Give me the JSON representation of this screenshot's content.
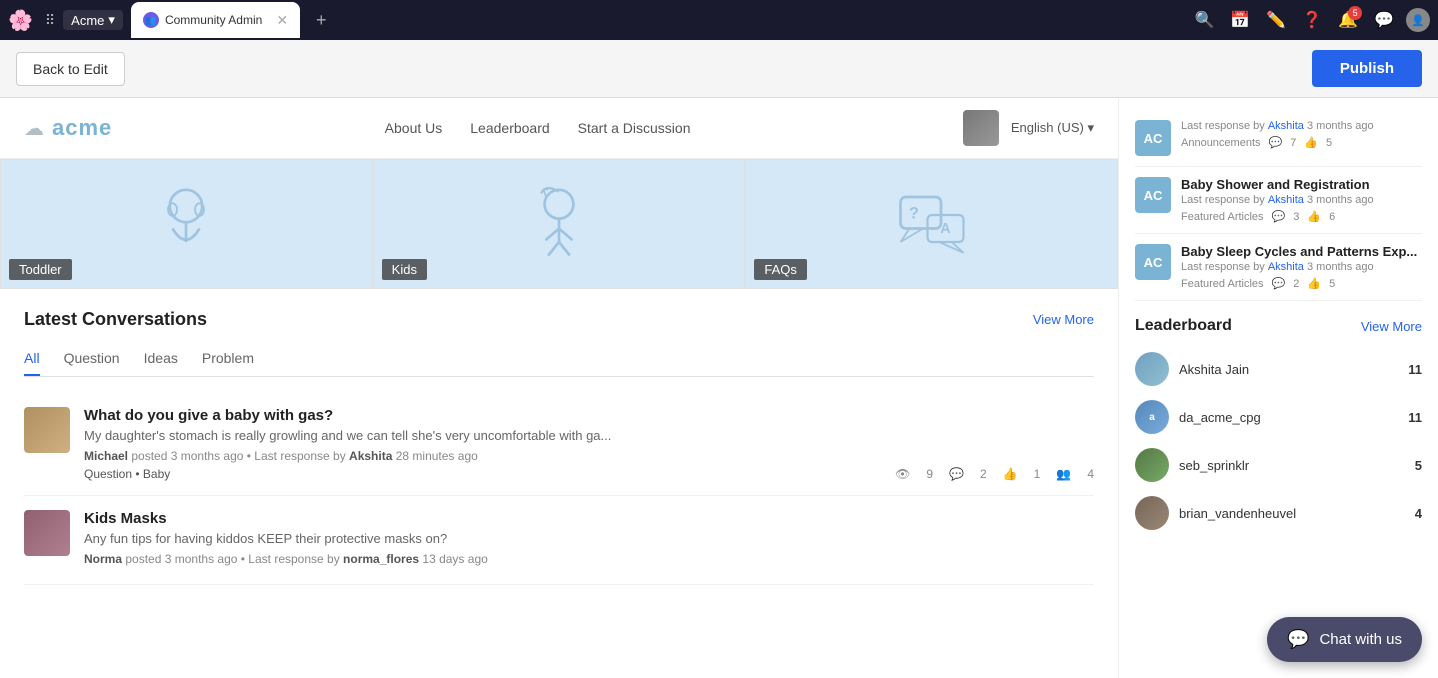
{
  "chrome": {
    "logo": "🌸",
    "app_name": "Acme",
    "app_dropdown": "▾",
    "tab_label": "Community Admin",
    "new_tab": "+",
    "icons": [
      "search",
      "calendar",
      "edit",
      "help",
      "bell",
      "chat",
      "user"
    ],
    "notification_count": "5"
  },
  "editor_bar": {
    "back_label": "Back to Edit",
    "publish_label": "Publish"
  },
  "site_nav": {
    "logo_text": "acme",
    "links": [
      "About Us",
      "Leaderboard",
      "Start a Discussion"
    ],
    "language": "English (US)"
  },
  "categories": [
    {
      "id": "toddler",
      "label": "Toddler"
    },
    {
      "id": "kids",
      "label": "Kids"
    },
    {
      "id": "faqs",
      "label": "FAQs"
    }
  ],
  "conversations": {
    "section_title": "Latest Conversations",
    "view_more": "View More",
    "tabs": [
      "All",
      "Question",
      "Ideas",
      "Problem"
    ],
    "active_tab": "All",
    "items": [
      {
        "id": 1,
        "title": "What do you give a baby with gas?",
        "excerpt": "My daughter's stomach is really growling and we can tell she's very uncomfortable with ga...",
        "author": "Michael",
        "posted": "posted 3 months ago",
        "last_response_by": "Akshita",
        "last_response_time": "28 minutes ago",
        "tag": "Question • Baby",
        "views": 9,
        "comments": 2,
        "likes": 1,
        "participants": 4
      },
      {
        "id": 2,
        "title": "Kids Masks",
        "excerpt": "Any fun tips for having kiddos KEEP their protective masks on?",
        "author": "Norma",
        "posted": "posted 3 months ago",
        "last_response_by": "norma_flores",
        "last_response_time": "13 days ago",
        "tag": "",
        "views": null,
        "comments": null,
        "likes": null,
        "participants": null
      }
    ]
  },
  "sidebar": {
    "recent_items": [
      {
        "avatar_initials": "AC",
        "title": "Last response by Akshita 3 months ago",
        "category": "Announcements",
        "comments": 7,
        "likes": 5
      },
      {
        "avatar_initials": "AC",
        "title": "Baby Shower and Registration",
        "subtitle_by": "Akshita",
        "subtitle_time": "3 months ago",
        "category": "Featured Articles",
        "comments": 3,
        "likes": 6
      },
      {
        "avatar_initials": "AC",
        "title": "Baby Sleep Cycles and Patterns Exp...",
        "subtitle_by": "Akshita",
        "subtitle_time": "3 months ago",
        "category": "Featured Articles",
        "comments": 2,
        "likes": 5
      }
    ],
    "leaderboard": {
      "title": "Leaderboard",
      "view_more": "View More",
      "items": [
        {
          "name": "Akshita Jain",
          "score": 11
        },
        {
          "name": "da_acme_cpg",
          "score": 11
        },
        {
          "name": "seb_sprinklr",
          "score": 5
        },
        {
          "name": "brian_vandenheuvel",
          "score": 4
        }
      ]
    }
  },
  "chat_widget": {
    "label": "Chat with us"
  }
}
